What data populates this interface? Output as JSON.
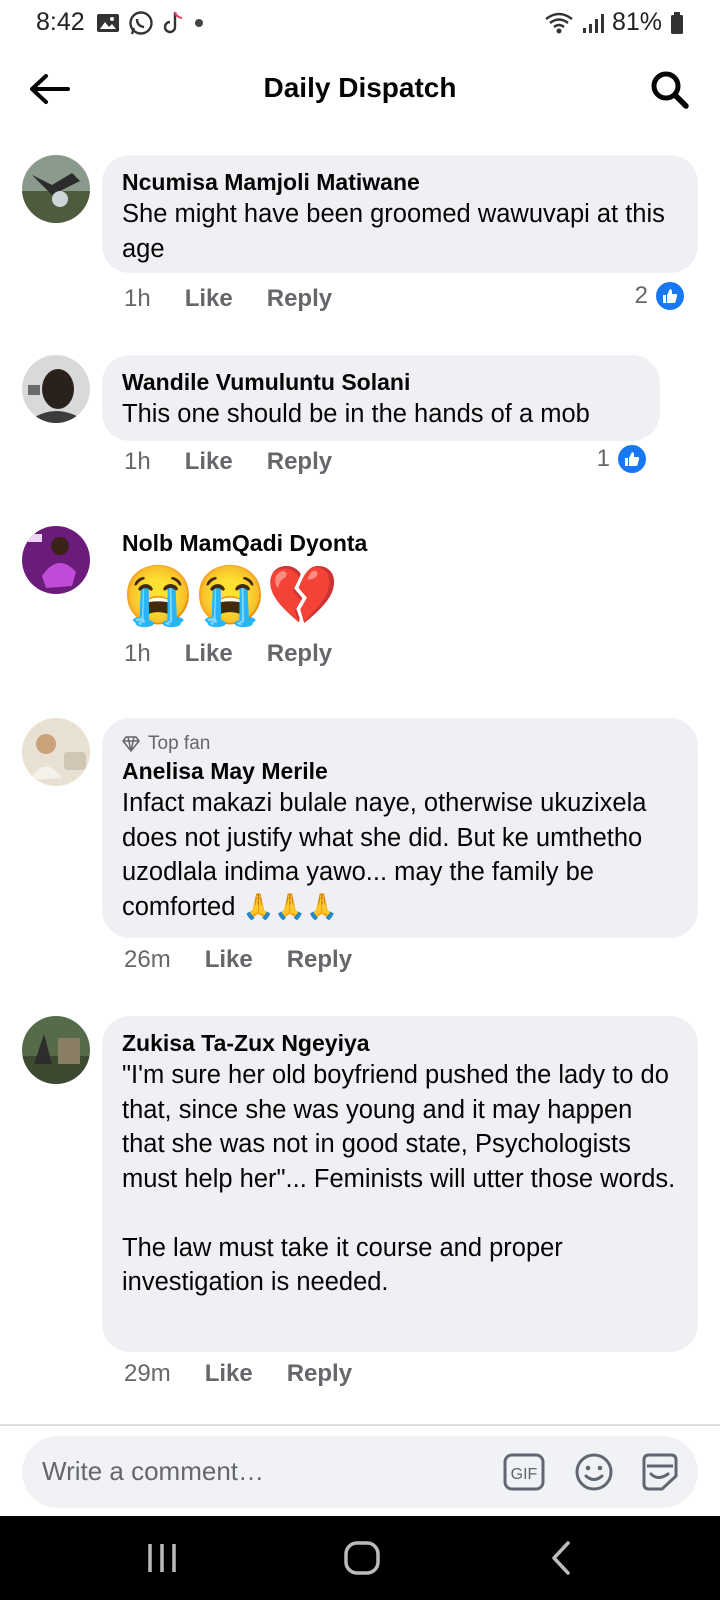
{
  "status": {
    "time": "8:42",
    "battery": "81%"
  },
  "header": {
    "title": "Daily Dispatch"
  },
  "comments": [
    {
      "author": "Ncumisa Mamjoli Matiwane",
      "text": "She might have been groomed wawuvapi at this age",
      "time": "1h",
      "like": "Like",
      "reply": "Reply",
      "likes": "2"
    },
    {
      "author": "Wandile Vumuluntu Solani",
      "text": "This one should be in the hands of a mob",
      "time": "1h",
      "like": "Like",
      "reply": "Reply",
      "likes": "1"
    },
    {
      "author": "Nolb MamQadi Dyonta",
      "text": "😭😭💔",
      "time": "1h",
      "like": "Like",
      "reply": "Reply"
    },
    {
      "badge": "Top fan",
      "author": "Anelisa May Merile",
      "text": "Infact makazi bulale naye, otherwise ukuzixela does not justify what she did. But ke umthetho uzodlala indima yawo... may the family be comforted 🙏🙏🙏",
      "time": "26m",
      "like": "Like",
      "reply": "Reply"
    },
    {
      "author": "Zukisa Ta-Zux Ngeyiya",
      "text": "\"I'm sure her old boyfriend pushed the lady to do that, since she was young and it may happen that she was not in good state, Psychologists must help her\"... Feminists will utter those words.\n\nThe law must take it course and proper investigation is needed.",
      "time": "29m",
      "like": "Like",
      "reply": "Reply"
    }
  ],
  "composer": {
    "placeholder": "Write a comment…",
    "gif": "GIF"
  },
  "colors": {
    "accent": "#1877f2",
    "bubble": "#eff0f4",
    "muted": "#65676b"
  }
}
